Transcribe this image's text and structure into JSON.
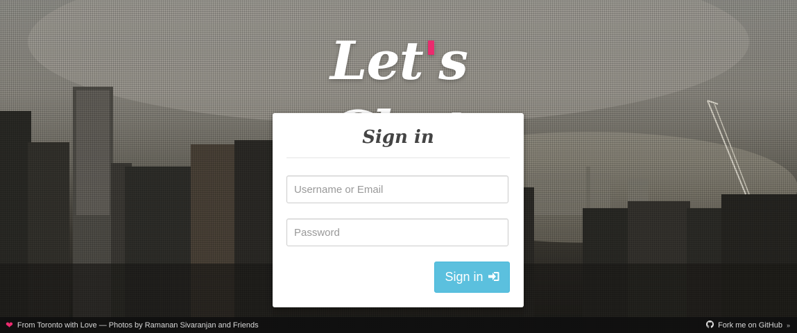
{
  "app": {
    "logo_text_1": "Let",
    "logo_apostrophe": "'",
    "logo_text_2": "s Chat",
    "accent_color": "#ec2a6e"
  },
  "login": {
    "title": "Sign in",
    "username_placeholder": "Username or Email",
    "password_placeholder": "Password",
    "submit_label": "Sign in",
    "submit_icon": "sign-in-icon",
    "button_color": "#5bc0de"
  },
  "footer": {
    "heart_icon": "heart-icon",
    "credit_text": "From Toronto with Love — Photos by Ramanan Sivaranjan and Friends",
    "github_icon": "github-icon",
    "github_text": "Fork me on GitHub",
    "github_chevron": "»"
  }
}
